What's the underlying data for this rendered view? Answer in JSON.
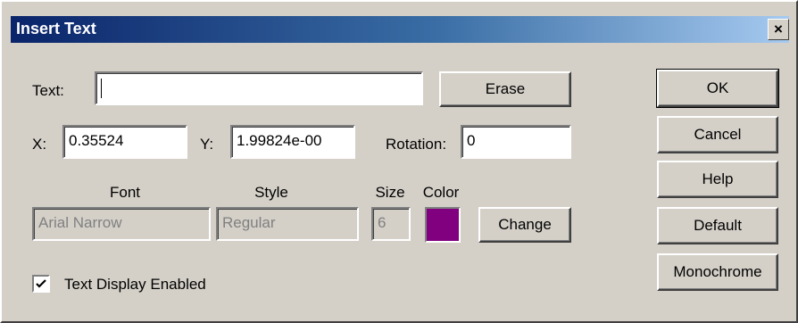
{
  "window": {
    "title": "Insert Text",
    "close_glyph": "×"
  },
  "text_field": {
    "label": "Text:",
    "mnemonic": "T",
    "value": ""
  },
  "buttons": {
    "erase": "Erase",
    "ok": "OK",
    "cancel": "Cancel",
    "help": "Help",
    "default": "Default",
    "monochrome": "Monochrome",
    "change": "Change"
  },
  "coords": {
    "x_label": "X:",
    "x_value": "0.35524",
    "y_label": "Y:",
    "y_value": "1.99824e-00",
    "rotation_label": "Rotation:",
    "rotation_value": "0"
  },
  "font_section": {
    "font_header": "Font",
    "font_value": "Arial Narrow",
    "style_header": "Style",
    "style_value": "Regular",
    "size_header": "Size",
    "size_value": "6",
    "color_header": "Color",
    "color_value": "#800080"
  },
  "text_display": {
    "label": "Text Display Enabled",
    "checked": true
  },
  "icons": {
    "close": "close-icon",
    "check": "checkmark-icon"
  }
}
